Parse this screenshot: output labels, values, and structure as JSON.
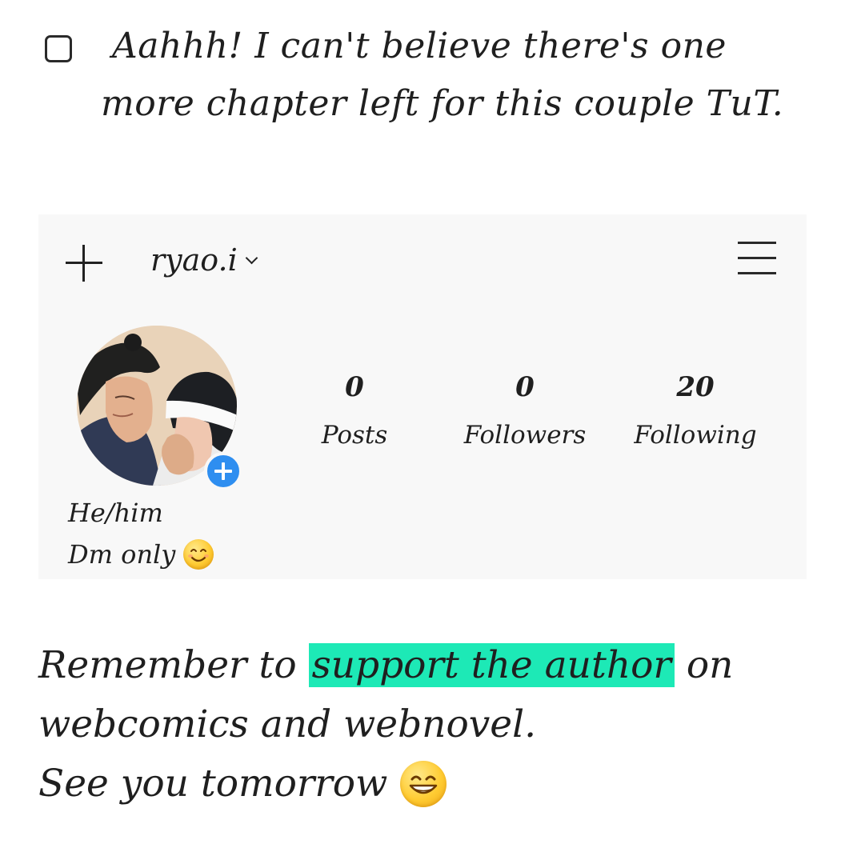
{
  "note": {
    "line1": "Aahhh! I can't believe there's one",
    "line2": "more chapter left for this couple TuT."
  },
  "profile": {
    "username": "ryao.i",
    "stats": [
      {
        "count": "0",
        "label": "Posts"
      },
      {
        "count": "0",
        "label": "Followers"
      },
      {
        "count": "20",
        "label": "Following"
      }
    ],
    "bio": {
      "line1": "He/him",
      "line2": "Dm only"
    },
    "accent_color": "#2e8ef0",
    "card_background": "#f8f8f8"
  },
  "footer": {
    "line1_before": "Remember to ",
    "line1_highlight": "support the author",
    "line1_after": " on",
    "line2": "webcomics and webnovel.",
    "line3": "See you tomorrow",
    "highlight_color": "#1de9b6"
  },
  "icons": {
    "checkbox": "checkbox-empty-icon",
    "add": "plus-icon",
    "username_menu": "chevron-down-icon",
    "menu": "hamburger-menu-icon",
    "avatar_add": "add-story-icon",
    "bio_emoji": "smiling-face-icon",
    "footer_emoji": "grinning-face-icon"
  }
}
